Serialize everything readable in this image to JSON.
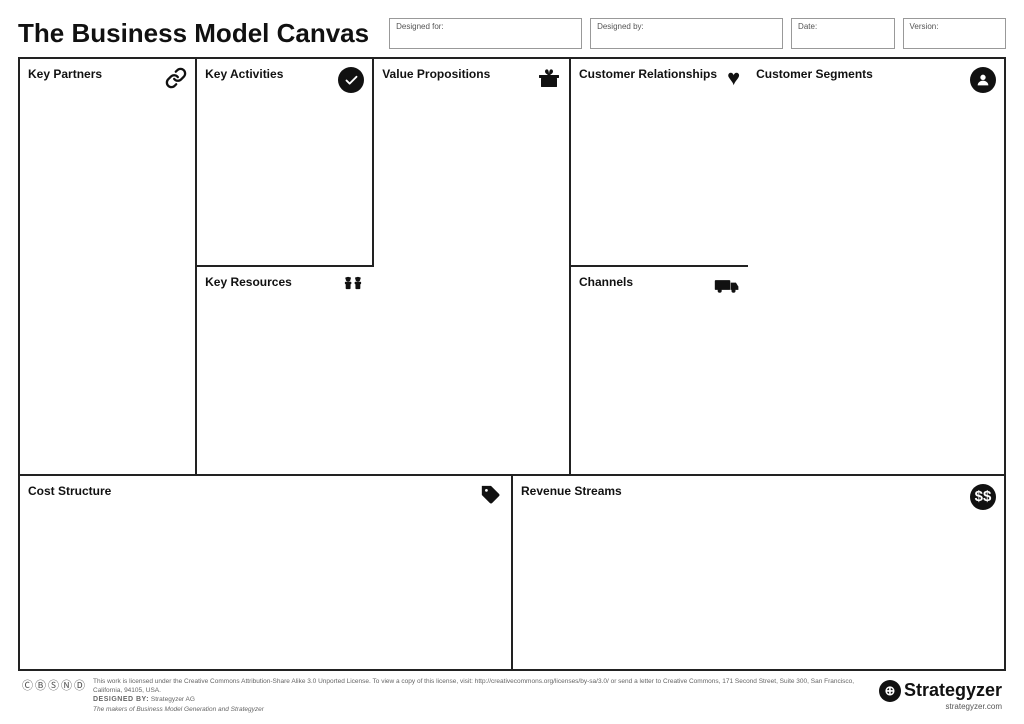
{
  "page": {
    "title": "The Business Model Canvas"
  },
  "header": {
    "designed_for_label": "Designed for:",
    "designed_for_value": "",
    "designed_by_label": "Designed by:",
    "designed_by_value": "",
    "date_label": "Date:",
    "date_value": "",
    "version_label": "Version:",
    "version_value": ""
  },
  "canvas": {
    "key_partners": "Key Partners",
    "key_activities": "Key Activities",
    "key_resources": "Key Resources",
    "value_propositions": "Value Propositions",
    "customer_relationships": "Customer Relationships",
    "channels": "Channels",
    "customer_segments": "Customer Segments",
    "cost_structure": "Cost Structure",
    "revenue_streams": "Revenue Streams"
  },
  "footer": {
    "cc_text": "This work is licensed under the Creative Commons Attribution-Share Alike 3.0 Unported License. To view a copy of this license, visit:\nhttp://creativecommons.org/licenses/by-sa/3.0/ or send a letter to Creative Commons, 171 Second Street, Suite 300, San Francisco, California, 94105, USA.",
    "designed_by_label": "DESIGNED BY:",
    "designed_by_value": "Strategyzer AG",
    "tagline": "The makers of Business Model Generation and Strategyzer",
    "logo_text": "Strategyzer",
    "logo_symbol": "⊕",
    "url": "strategyzer.com"
  }
}
